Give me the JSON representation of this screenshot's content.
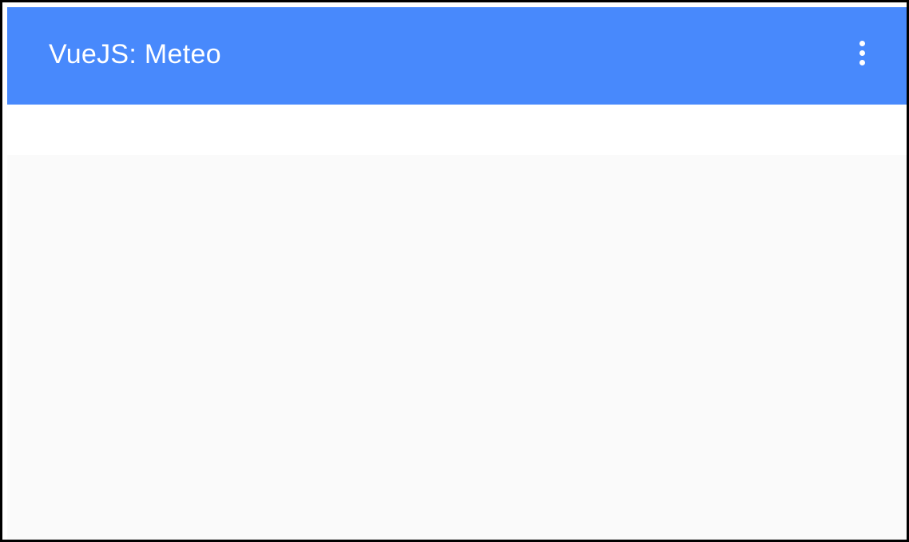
{
  "app": {
    "title": "VueJS: Meteo"
  },
  "toolbar": {
    "menu_icon": "more-vert-icon"
  },
  "colors": {
    "primary": "#4889fc",
    "toolbar_text": "#ffffff",
    "surface": "#ffffff",
    "background": "#fafafa",
    "frame_border": "#000000"
  }
}
